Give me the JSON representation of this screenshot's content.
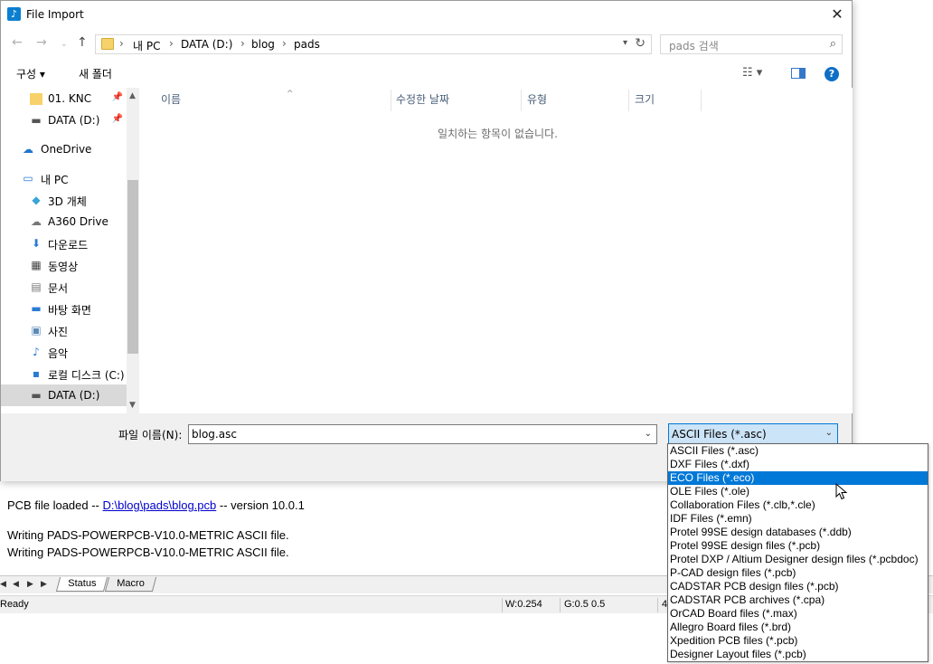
{
  "background_app": {
    "log_prefix": "PCB file loaded -- ",
    "log_link": "D:\\blog\\pads\\blog.pcb",
    "log_suffix": " -- version 10.0.1",
    "log_line2": "Writing PADS-POWERPCB-V10.0-METRIC ASCII file.",
    "log_line3": "Writing PADS-POWERPCB-V10.0-METRIC ASCII file.",
    "tabs": [
      "Status",
      "Macro"
    ],
    "status": {
      "ready": "Ready",
      "w": "W:0.254",
      "g": "G:0.5 0.5",
      "extra": "4"
    }
  },
  "dialog": {
    "title": "File Import",
    "breadcrumb": [
      "내 PC",
      "DATA (D:)",
      "blog",
      "pads"
    ],
    "search_placeholder": "pads 검색",
    "toolbar": {
      "organize": "구성 ▾",
      "new_folder": "새 폴더"
    },
    "sidebar": [
      {
        "label": "01. KNC",
        "icon": "folder-icon"
      },
      {
        "label": "DATA (D:)",
        "icon": "drive-icon"
      },
      {
        "label": "OneDrive",
        "icon": "cloud-icon"
      },
      {
        "label": "내 PC",
        "icon": "computer-icon"
      },
      {
        "label": "3D 개체",
        "icon": "cube-icon"
      },
      {
        "label": "A360 Drive",
        "icon": "a360-icon"
      },
      {
        "label": "다운로드",
        "icon": "download-icon"
      },
      {
        "label": "동영상",
        "icon": "video-icon"
      },
      {
        "label": "문서",
        "icon": "document-icon"
      },
      {
        "label": "바탕 화면",
        "icon": "desktop-icon"
      },
      {
        "label": "사진",
        "icon": "pictures-icon"
      },
      {
        "label": "음악",
        "icon": "music-icon"
      },
      {
        "label": "로컬 디스크 (C:)",
        "icon": "windows-drive-icon"
      },
      {
        "label": "DATA (D:)",
        "icon": "drive-icon"
      }
    ],
    "columns": [
      "이름",
      "수정한 날짜",
      "유형",
      "크기"
    ],
    "empty_message": "일치하는 항목이 없습니다.",
    "filename_label": "파일 이름(N):",
    "filename_value": "blog.asc",
    "filetype_selected": "ASCII Files (*.asc)",
    "filetype_options": [
      "ASCII Files (*.asc)",
      "DXF Files (*.dxf)",
      "ECO Files (*.eco)",
      "OLE Files (*.ole)",
      "Collaboration Files (*.clb,*.cle)",
      "IDF Files (*.emn)",
      "Protel 99SE design databases (*.ddb)",
      "Protel 99SE design files (*.pcb)",
      "Protel DXP / Altium Designer design files (*.pcbdoc)",
      "P-CAD design files (*.pcb)",
      "CADSTAR PCB design files (*.pcb)",
      "CADSTAR PCB archives (*.cpa)",
      "OrCAD Board files (*.max)",
      "Allegro Board files (*.brd)",
      "Xpedition PCB files (*.pcb)",
      "Designer Layout files (*.pcb)"
    ],
    "highlighted_option": "ECO Files (*.eco)"
  },
  "colors": {
    "accent": "#0078d7",
    "selection": "#cce4f7",
    "sidebar_selected": "#d9d9d9"
  }
}
